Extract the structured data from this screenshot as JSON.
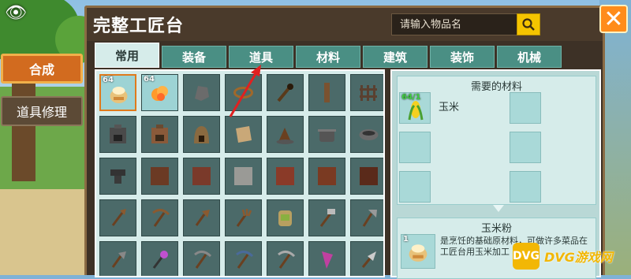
{
  "window": {
    "title": "完整工匠台"
  },
  "search": {
    "placeholder": "请输入物品名"
  },
  "side_tabs": [
    {
      "label": "合成"
    },
    {
      "label": "道具修理"
    }
  ],
  "tabs": [
    {
      "label": "常用"
    },
    {
      "label": "装备"
    },
    {
      "label": "道具"
    },
    {
      "label": "材料"
    },
    {
      "label": "建筑"
    },
    {
      "label": "装饰"
    },
    {
      "label": "机械"
    }
  ],
  "grid_counts": {
    "slot0": "64",
    "slot1": "64"
  },
  "materials": {
    "title": "需要的材料",
    "count": "64",
    "ratio": "/1",
    "name": "玉米"
  },
  "result": {
    "title": "玉米粉",
    "count": "1",
    "description": "是烹饪的基础原材料，可做许多菜品在工匠台用玉米加工"
  },
  "watermark": {
    "logo": "DVG",
    "text": "DVG游戏网"
  },
  "colors": {
    "accent": "#d26b1f",
    "tab": "#4a8f84",
    "panel": "#d6ecea",
    "close": "#ff8c1a",
    "search_btn": "#f5c400"
  }
}
